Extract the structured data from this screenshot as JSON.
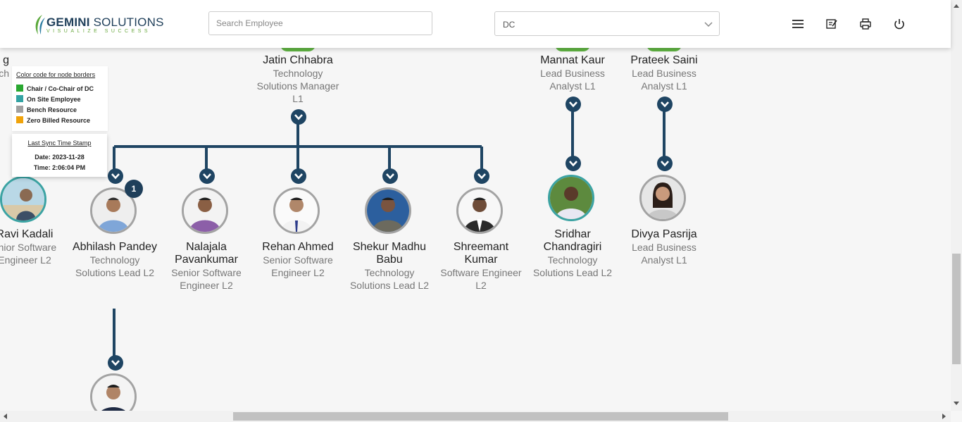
{
  "header": {
    "logo_brand": "GEMINI",
    "logo_suffix": " SOLUTIONS",
    "logo_tagline": "VISUALIZE SUCCESS",
    "search_placeholder": "Search Employee",
    "department_value": "DC",
    "icons": [
      "menu-icon",
      "edit-note-icon",
      "print-icon",
      "power-icon"
    ]
  },
  "legend": {
    "title": "Color code for node borders",
    "items": [
      {
        "label": "Chair / Co-Chair of DC",
        "color": "#2aa831"
      },
      {
        "label": "On Site Employee",
        "color": "#33a3a3"
      },
      {
        "label": "Bench Resource",
        "color": "#a0a0a0"
      },
      {
        "label": "Zero Billed Resource",
        "color": "#f0a30a"
      }
    ]
  },
  "sync": {
    "title": "Last Sync Time Stamp",
    "date": "Date: 2023-11-28",
    "time": "Time: 2:06:04 PM"
  },
  "nodes_top": [
    {
      "name": "g",
      "role": "ch"
    },
    {
      "name": "Jatin Chhabra",
      "role": "Technology Solutions Manager L1"
    },
    {
      "name": "Mannat Kaur",
      "role": "Lead Business Analyst L1"
    },
    {
      "name": "Prateek Saini",
      "role": "Lead Business Analyst L1"
    }
  ],
  "nodes_level2": [
    {
      "name": "Ravi Kadali",
      "role": "enior Software Engineer L2",
      "border": "teal"
    },
    {
      "name": "Abhilash Pandey",
      "role": "Technology Solutions Lead L2",
      "border": "gray",
      "badge": "1"
    },
    {
      "name": "Nalajala Pavankumar",
      "role": "Senior Software Engineer L2",
      "border": "gray"
    },
    {
      "name": "Rehan Ahmed",
      "role": "Senior Software Engineer L2",
      "border": "gray"
    },
    {
      "name": "Shekur Madhu Babu",
      "role": "Technology Solutions Lead L2",
      "border": "gray"
    },
    {
      "name": "Shreemant Kumar",
      "role": "Software Engineer L2",
      "border": "gray"
    },
    {
      "name": "Sridhar Chandragiri",
      "role": "Technology Solutions Lead L2",
      "border": "teal"
    },
    {
      "name": "Divya Pasrija",
      "role": "Lead Business Analyst L1",
      "border": "gray"
    }
  ]
}
